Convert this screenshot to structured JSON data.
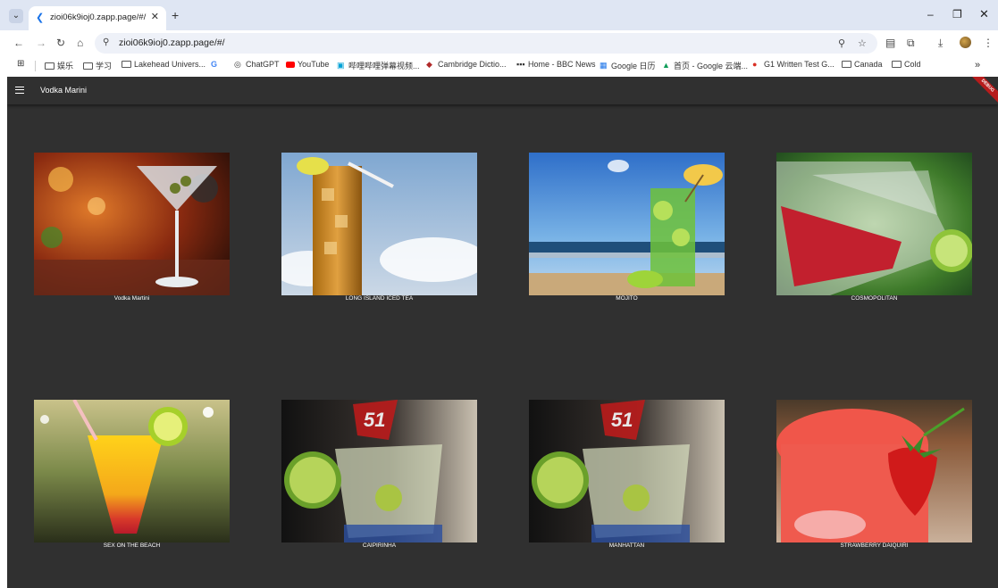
{
  "browser": {
    "tab": {
      "title": "zioi06k9ioj0.zapp.page/#/"
    },
    "address": {
      "url": "zioi06k9ioj0.zapp.page/#/"
    },
    "icons": [
      "tab-list-icon",
      "favicon-icon",
      "close-icon",
      "new-tab-icon",
      "minimize-icon",
      "restore-icon",
      "window-close-icon",
      "back-icon",
      "forward-icon",
      "reload-icon",
      "home-icon",
      "site-info-icon",
      "zoom-icon",
      "star-icon",
      "reading-list-icon",
      "extensions-icon",
      "download-icon",
      "avatar",
      "menu-icon",
      "apps-icon",
      "more-bookmarks-icon"
    ],
    "bookmarks": [
      "娱乐",
      "学习",
      "Lakehead Univers...",
      "ChatGPT",
      "YouTube",
      "哔哩哔哩弹幕视频...",
      "Cambridge Dictio...",
      "Home - BBC News",
      "Google 日历",
      "首页 - Google 云端...",
      "G1 Written Test G...",
      "Canada",
      "Cold"
    ]
  },
  "app": {
    "title": "Vodka Marini",
    "banner": "DEBUG",
    "cocktails": [
      {
        "name": "Vodka Martini"
      },
      {
        "name": "LONG ISLAND ICED TEA"
      },
      {
        "name": "MOJITO"
      },
      {
        "name": "COSMOPOLITAN"
      },
      {
        "name": "SEX ON THE BEACH"
      },
      {
        "name": "CAIPIRINHA"
      },
      {
        "name": "MANHATTAN"
      },
      {
        "name": "STRAWBERRY DAIQUIRI"
      }
    ]
  }
}
